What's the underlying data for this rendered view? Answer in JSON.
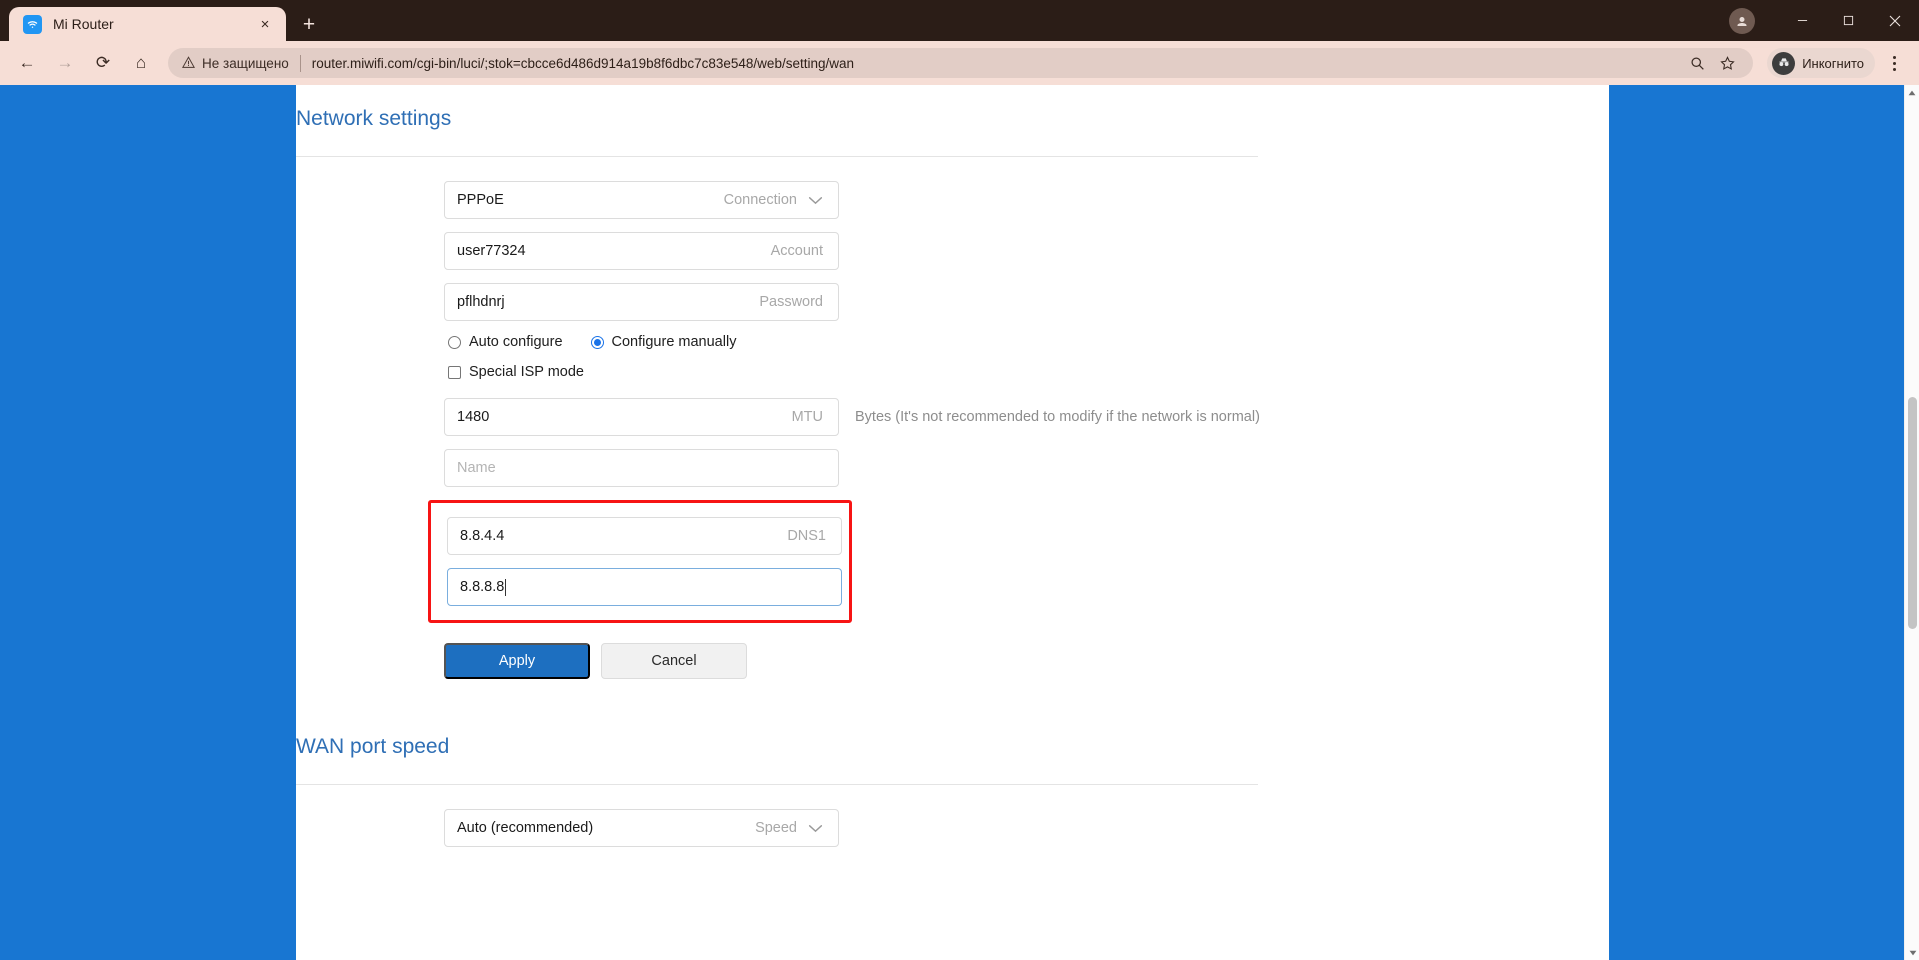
{
  "browser": {
    "tab": {
      "title": "Mi Router",
      "favicon": "wifi-icon",
      "close": "×"
    },
    "new_tab": "+",
    "window_controls": {
      "minimize": "—",
      "maximize": "❐",
      "close": "×"
    },
    "nav": {
      "back": "←",
      "forward": "→",
      "reload": "⟳",
      "home": "⌂"
    },
    "omnibox": {
      "warning_icon": "warning-triangle-icon",
      "security_label": "Не защищено",
      "url": "router.miwifi.com/cgi-bin/luci/;stok=cbcce6d486d914a19b8f6dbc7c83e548/web/setting/wan",
      "zoom_icon": "search-icon",
      "bookmark_icon": "star-icon"
    },
    "incognito": {
      "label": "Инкогнито",
      "avatar_icon": "incognito-icon"
    },
    "menu": "menu-dots-icon"
  },
  "page": {
    "network_settings": {
      "heading": "Network settings",
      "fields": {
        "connection": {
          "value": "PPPoE",
          "label": "Connection",
          "chevron": "⌄"
        },
        "account": {
          "value": "user77324",
          "label": "Account"
        },
        "password": {
          "value": "pflhdnrj",
          "label": "Password"
        },
        "mtu": {
          "value": "1480",
          "label": "MTU",
          "hint": "Bytes (It's not recommended to modify if the network is normal)"
        },
        "name": {
          "value": "",
          "placeholder": "Name",
          "label": ""
        },
        "dns1": {
          "value": "8.8.4.4",
          "label": "DNS1"
        },
        "dns2": {
          "value": "8.8.8.8",
          "label": ""
        }
      },
      "radios": [
        {
          "label": "Auto configure",
          "selected": false
        },
        {
          "label": "Configure manually",
          "selected": true
        }
      ],
      "checkbox": {
        "label": "Special ISP mode",
        "checked": false
      },
      "buttons": {
        "apply": "Apply",
        "cancel": "Cancel"
      },
      "highlight_color": "#f71414",
      "accent_color": "#1d6fc0"
    },
    "wan_port_speed": {
      "heading": "WAN port speed",
      "speed": {
        "value": "Auto (recommended)",
        "label": "Speed",
        "chevron": "⌄"
      }
    }
  }
}
